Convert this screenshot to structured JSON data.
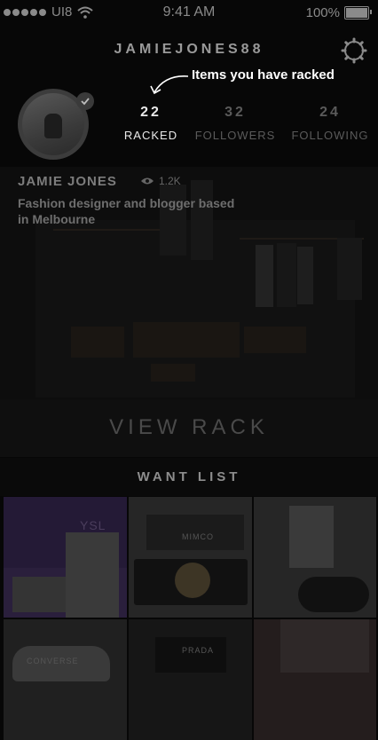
{
  "status_bar": {
    "carrier": "UI8",
    "time": "9:41 AM",
    "battery_pct": "100%"
  },
  "header": {
    "username": "JAMIEJONES88"
  },
  "tooltip": {
    "text": "Items you have racked"
  },
  "profile": {
    "name": "JAMIE JONES",
    "views": "1.2K",
    "bio": "Fashion designer and blogger based in Melbourne",
    "stats": [
      {
        "value": "22",
        "label": "RACKED"
      },
      {
        "value": "32",
        "label": "FOLLOWERS"
      },
      {
        "value": "24",
        "label": "FOLLOWING"
      }
    ]
  },
  "rack": {
    "button_label": "VIEW RACK"
  },
  "want_list": {
    "title": "WANT LIST",
    "items": [
      {
        "brand": "YSL",
        "accent": "#2a1f3c"
      },
      {
        "brand": "MIMCO",
        "accent": "#1e1e1e"
      },
      {
        "brand": "",
        "accent": "#262626"
      },
      {
        "brand": "CONVERSE",
        "accent": "#202020"
      },
      {
        "brand": "PRADA",
        "accent": "#161616"
      },
      {
        "brand": "",
        "accent": "#241d1d"
      }
    ]
  },
  "colors": {
    "background": "#070707",
    "active_text": "#e9e9e9",
    "dim_text": "#5a5a5a"
  }
}
